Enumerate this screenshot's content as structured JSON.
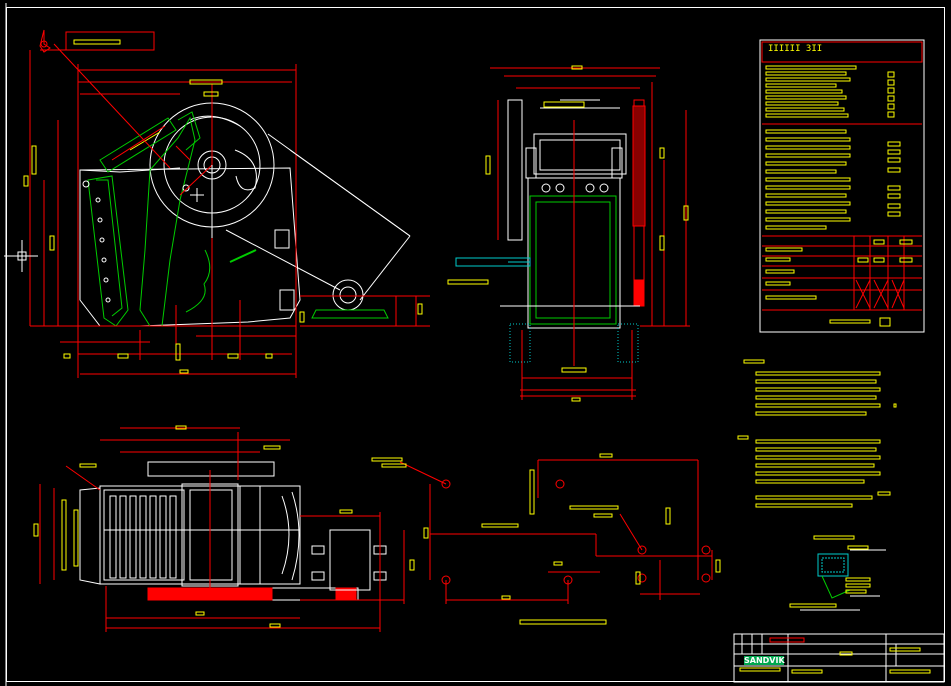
{
  "drawing": {
    "background": "#000000",
    "colors": {
      "outline": "#ffffff",
      "dimension": "#ff0000",
      "text_bar": "#ffff00",
      "liner": "#00cc00",
      "cyan": "#00cccc",
      "fill_red": "#ff0000"
    }
  },
  "views": [
    {
      "id": "side-view",
      "name": "side-elevation"
    },
    {
      "id": "front-view",
      "name": "front-elevation"
    },
    {
      "id": "plan-view",
      "name": "plan-view"
    },
    {
      "id": "foundation-plan",
      "name": "foundation-bolt-layout"
    },
    {
      "id": "detail-view",
      "name": "detail-callout"
    }
  ],
  "title_block": {
    "logo_text": "SANDVIK",
    "label": "IIIIII 3II"
  },
  "legend": {
    "icon": "crosshair-icon"
  }
}
